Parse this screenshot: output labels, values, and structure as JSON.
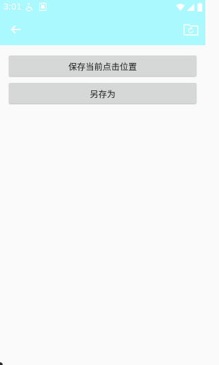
{
  "status_bar": {
    "time": "3:01",
    "icons": [
      "accessibility-icon",
      "app-notification-icon",
      "wifi-icon",
      "signal-icon",
      "battery-icon"
    ]
  },
  "app_bar": {
    "back_icon": "arrow-back-icon",
    "action_icon": "folder-refresh-icon",
    "background": "#aaf9ff"
  },
  "main": {
    "save_current_label": "保存当前点击位置",
    "save_as_label": "另存为"
  }
}
